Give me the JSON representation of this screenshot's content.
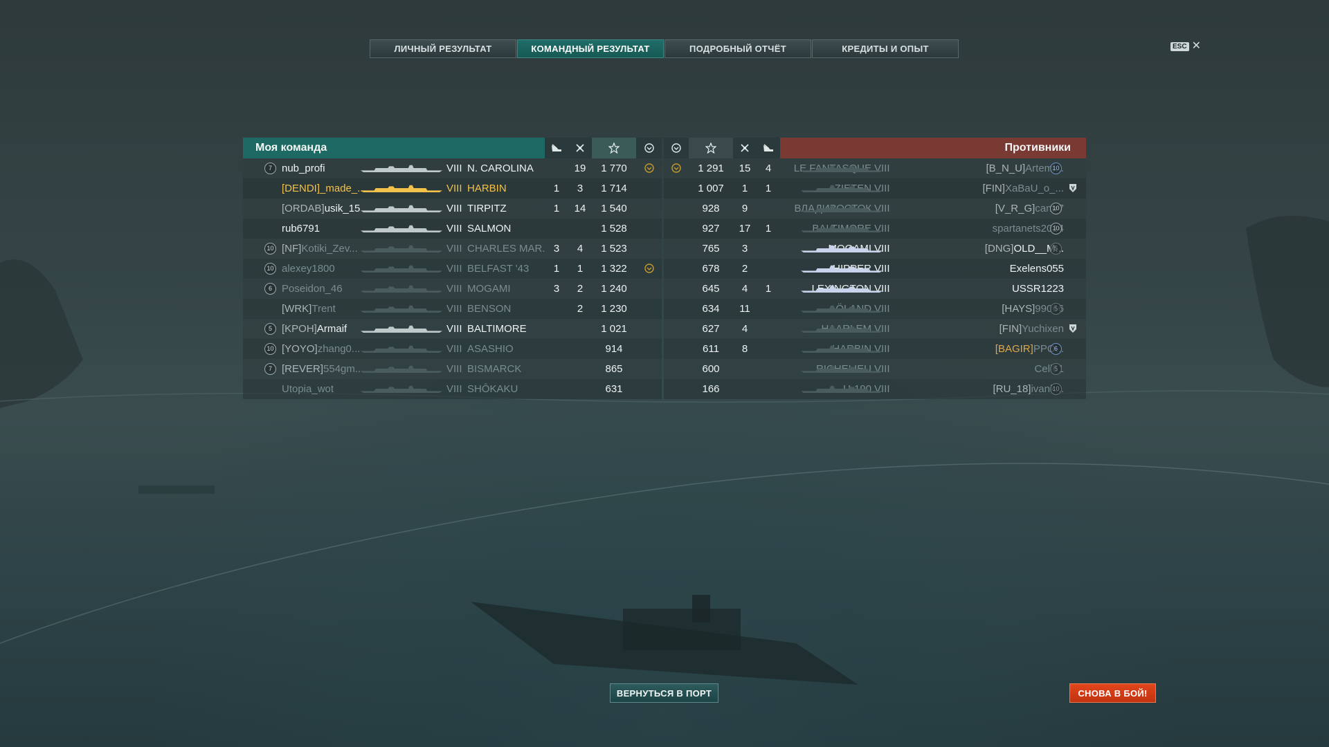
{
  "tabs": [
    {
      "label": "ЛИЧНЫЙ РЕЗУЛЬТАТ",
      "active": false
    },
    {
      "label": "КОМАНДНЫЙ РЕЗУЛЬТАТ",
      "active": true
    },
    {
      "label": "ПОДРОБНЫЙ ОТЧЁТ",
      "active": false
    },
    {
      "label": "КРЕДИТЫ И ОПЫТ",
      "active": false
    }
  ],
  "close": {
    "key": "ESC",
    "icon": "close-icon"
  },
  "my_team": {
    "title": "Моя команда",
    "columns": [
      "plane-kills-icon",
      "ship-kills-icon",
      "score-star-icon",
      "achievement-icon"
    ],
    "players": [
      {
        "rank": "7",
        "tag": "",
        "name": "nub_profi",
        "tier": "VIII",
        "ship": "N. CAROLINA",
        "planes": "",
        "kills": "19",
        "score": "1 770",
        "medal": true,
        "style": "bright"
      },
      {
        "rank": "",
        "tag": "[DENDI]",
        "name": "_made_...",
        "tier": "VIII",
        "ship": "HARBIN",
        "planes": "1",
        "kills": "3",
        "score": "1 714",
        "medal": false,
        "style": "gold"
      },
      {
        "rank": "",
        "tag": "[ORDAB]",
        "name": "usik_15",
        "tier": "VIII",
        "ship": "TIRPITZ",
        "planes": "1",
        "kills": "14",
        "score": "1 540",
        "medal": false,
        "style": "bright"
      },
      {
        "rank": "",
        "tag": "",
        "name": "rub6791",
        "tier": "VIII",
        "ship": "SALMON",
        "planes": "",
        "kills": "",
        "score": "1 528",
        "medal": false,
        "style": "bright"
      },
      {
        "rank": "10",
        "tag": "[NF]",
        "name": "Kotiki_Zev...",
        "tier": "VIII",
        "ship": "CHARLES MAR...",
        "planes": "3",
        "kills": "4",
        "score": "1 523",
        "medal": false,
        "style": "dim"
      },
      {
        "rank": "10",
        "tag": "",
        "name": "alexey1800",
        "tier": "VIII",
        "ship": "BELFAST '43",
        "planes": "1",
        "kills": "1",
        "score": "1 322",
        "medal": true,
        "style": "dim"
      },
      {
        "rank": "6",
        "tag": "",
        "name": "Poseidon_46",
        "tier": "VIII",
        "ship": "MOGAMI",
        "planes": "3",
        "kills": "2",
        "score": "1 240",
        "medal": false,
        "style": "dim"
      },
      {
        "rank": "",
        "tag": "[WRK]",
        "name": "Trent",
        "tier": "VIII",
        "ship": "BENSON",
        "planes": "",
        "kills": "2",
        "score": "1 230",
        "medal": false,
        "style": "dim"
      },
      {
        "rank": "5",
        "tag": "[KPOH]",
        "name": "Armaif",
        "tier": "VIII",
        "ship": "BALTIMORE",
        "planes": "",
        "kills": "",
        "score": "1 021",
        "medal": false,
        "style": "bright"
      },
      {
        "rank": "10",
        "tag": "[YOYO]",
        "name": "zhang0...",
        "tier": "VIII",
        "ship": "ASASHIO",
        "planes": "",
        "kills": "",
        "score": "914",
        "medal": false,
        "style": "dim"
      },
      {
        "rank": "7",
        "tag": "[REVER]",
        "name": "554gm...",
        "tier": "VIII",
        "ship": "BISMARCK",
        "planes": "",
        "kills": "",
        "score": "865",
        "medal": false,
        "style": "dim"
      },
      {
        "rank": "",
        "tag": "",
        "name": "Utopia_wot",
        "tier": "VIII",
        "ship": "SHŌKAKU",
        "planes": "",
        "kills": "",
        "score": "631",
        "medal": false,
        "style": "dim"
      }
    ]
  },
  "enemy_team": {
    "title": "Противники",
    "columns": [
      "achievement-icon",
      "score-star-icon",
      "ship-kills-icon",
      "plane-kills-icon"
    ],
    "players": [
      {
        "medal": true,
        "score": "1 291",
        "kills": "15",
        "planes": "4",
        "ship": "LE FANTASQUE",
        "tier": "VIII",
        "tag": "[B_N_U]",
        "name": "Artemi...",
        "rank": "10",
        "rank_style": "blue",
        "badge": "",
        "style": "dim"
      },
      {
        "medal": false,
        "score": "1 007",
        "kills": "1",
        "planes": "1",
        "ship": "ZIETEN",
        "tier": "VIII",
        "tag": "[FIN]",
        "name": "XaBaU_o_...",
        "rank": "",
        "rank_style": "",
        "badge": "shield",
        "style": "dim"
      },
      {
        "medal": false,
        "score": "928",
        "kills": "9",
        "planes": "",
        "ship": "ВЛАДИВОСТОК",
        "tier": "VIII",
        "tag": "[V_R_G]",
        "name": "cantr7",
        "rank": "10",
        "rank_style": "",
        "badge": "",
        "style": "dim"
      },
      {
        "medal": false,
        "score": "927",
        "kills": "17",
        "planes": "1",
        "ship": "BALTIMORE",
        "tier": "VIII",
        "tag": "",
        "name": "spartanets2014",
        "rank": "10",
        "rank_style": "",
        "badge": "",
        "style": "dim"
      },
      {
        "medal": false,
        "score": "765",
        "kills": "3",
        "planes": "",
        "ship": "MOGAMI",
        "tier": "VIII",
        "tag": "[DNG]",
        "name": "OLD__M...",
        "rank": "5",
        "rank_style": "dim",
        "badge": "",
        "style": "bright"
      },
      {
        "medal": false,
        "score": "678",
        "kills": "2",
        "planes": "",
        "ship": "HIPPER",
        "tier": "VIII",
        "tag": "",
        "name": "Exelens055",
        "rank": "",
        "rank_style": "",
        "badge": "",
        "style": "bright"
      },
      {
        "medal": false,
        "score": "645",
        "kills": "4",
        "planes": "1",
        "ship": "LEXINGTON",
        "tier": "VIII",
        "tag": "",
        "name": "USSR1223",
        "rank": "",
        "rank_style": "",
        "badge": "",
        "style": "bright"
      },
      {
        "medal": false,
        "score": "634",
        "kills": "11",
        "planes": "",
        "ship": "ÖLAND",
        "tier": "VIII",
        "tag": "[HAYS]",
        "name": "99066",
        "rank": "5",
        "rank_style": "dim",
        "badge": "",
        "style": "dim"
      },
      {
        "medal": false,
        "score": "627",
        "kills": "4",
        "planes": "",
        "ship": "HAARLEM",
        "tier": "VIII",
        "tag": "[FIN]",
        "name": "Yuchixen",
        "rank": "",
        "rank_style": "",
        "badge": "shield",
        "style": "dim"
      },
      {
        "medal": false,
        "score": "611",
        "kills": "8",
        "planes": "",
        "ship": "HARBIN",
        "tier": "VIII",
        "tag": "[BAGIR]",
        "name": "PPO...",
        "rank": "6",
        "rank_style": "blue",
        "badge": "",
        "style": "dim",
        "tag_color": "#e0a84a"
      },
      {
        "medal": false,
        "score": "600",
        "kills": "",
        "planes": "",
        "ship": "RICHELIEU",
        "tier": "VIII",
        "tag": "",
        "name": "Cell61",
        "rank": "5",
        "rank_style": "dim",
        "badge": "",
        "style": "dim"
      },
      {
        "medal": false,
        "score": "166",
        "kills": "",
        "planes": "",
        "ship": "U-190",
        "tier": "VIII",
        "tag": "[RU_18]",
        "name": "ivank...",
        "rank": "10",
        "rank_style": "dim",
        "badge": "",
        "style": "dim"
      }
    ]
  },
  "buttons": {
    "port": "ВЕРНУТЬСЯ В ПОРТ",
    "battle": "СНОВА В БОЙ!"
  },
  "colors": {
    "ally_header": "#1c6a63",
    "enemy_header": "#7a3a34",
    "highlight": "#f2c24a",
    "battle_button": "#d13c14"
  }
}
